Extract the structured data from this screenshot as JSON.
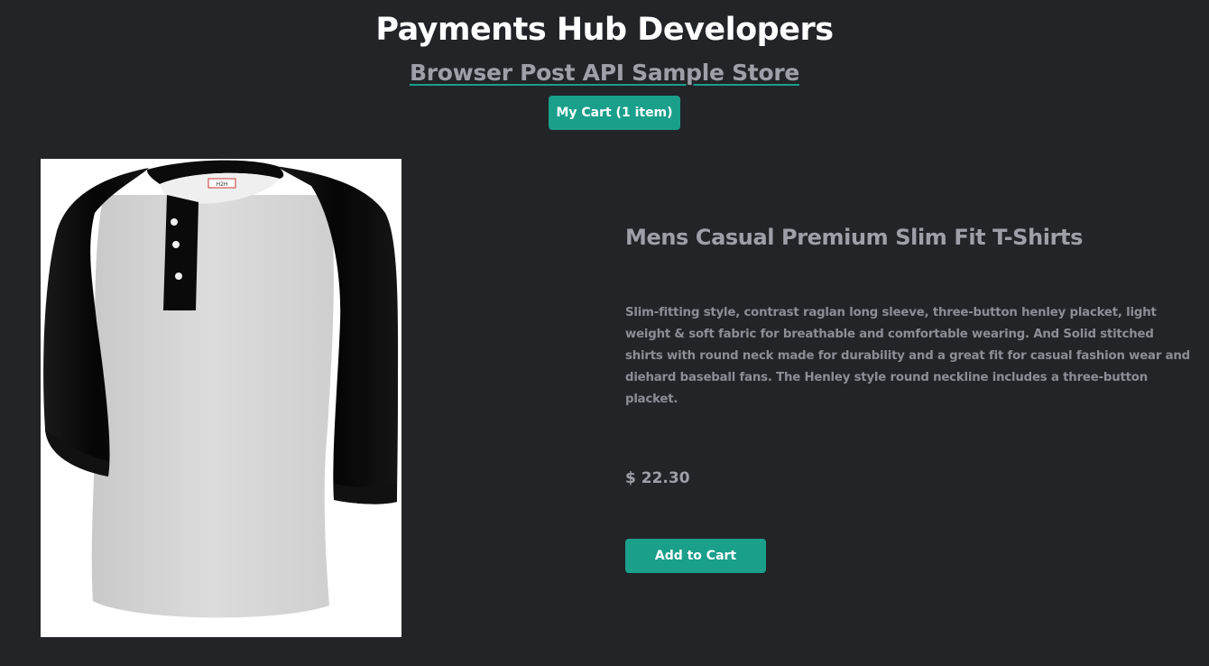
{
  "header": {
    "title": "Payments Hub Developers",
    "store_link": "Browser Post API Sample Store",
    "cart_label": "My Cart (1 item)"
  },
  "product": {
    "image_icon": "shirt-image",
    "image_tag_text": "H2H",
    "title": "Mens Casual Premium Slim Fit T-Shirts",
    "description": "Slim-fitting style, contrast raglan long sleeve, three-button henley placket, light weight & soft fabric for breathable and comfortable wearing. And Solid stitched shirts with round neck made for durability and a great fit for casual fashion wear and diehard baseball fans. The Henley style round neckline includes a three-button placket.",
    "price": "$ 22.30",
    "add_to_cart_label": "Add to Cart"
  },
  "colors": {
    "background": "#222428",
    "accent": "#1a9f8b",
    "title_text": "#ffffff",
    "muted_text": "#9da0a6"
  }
}
